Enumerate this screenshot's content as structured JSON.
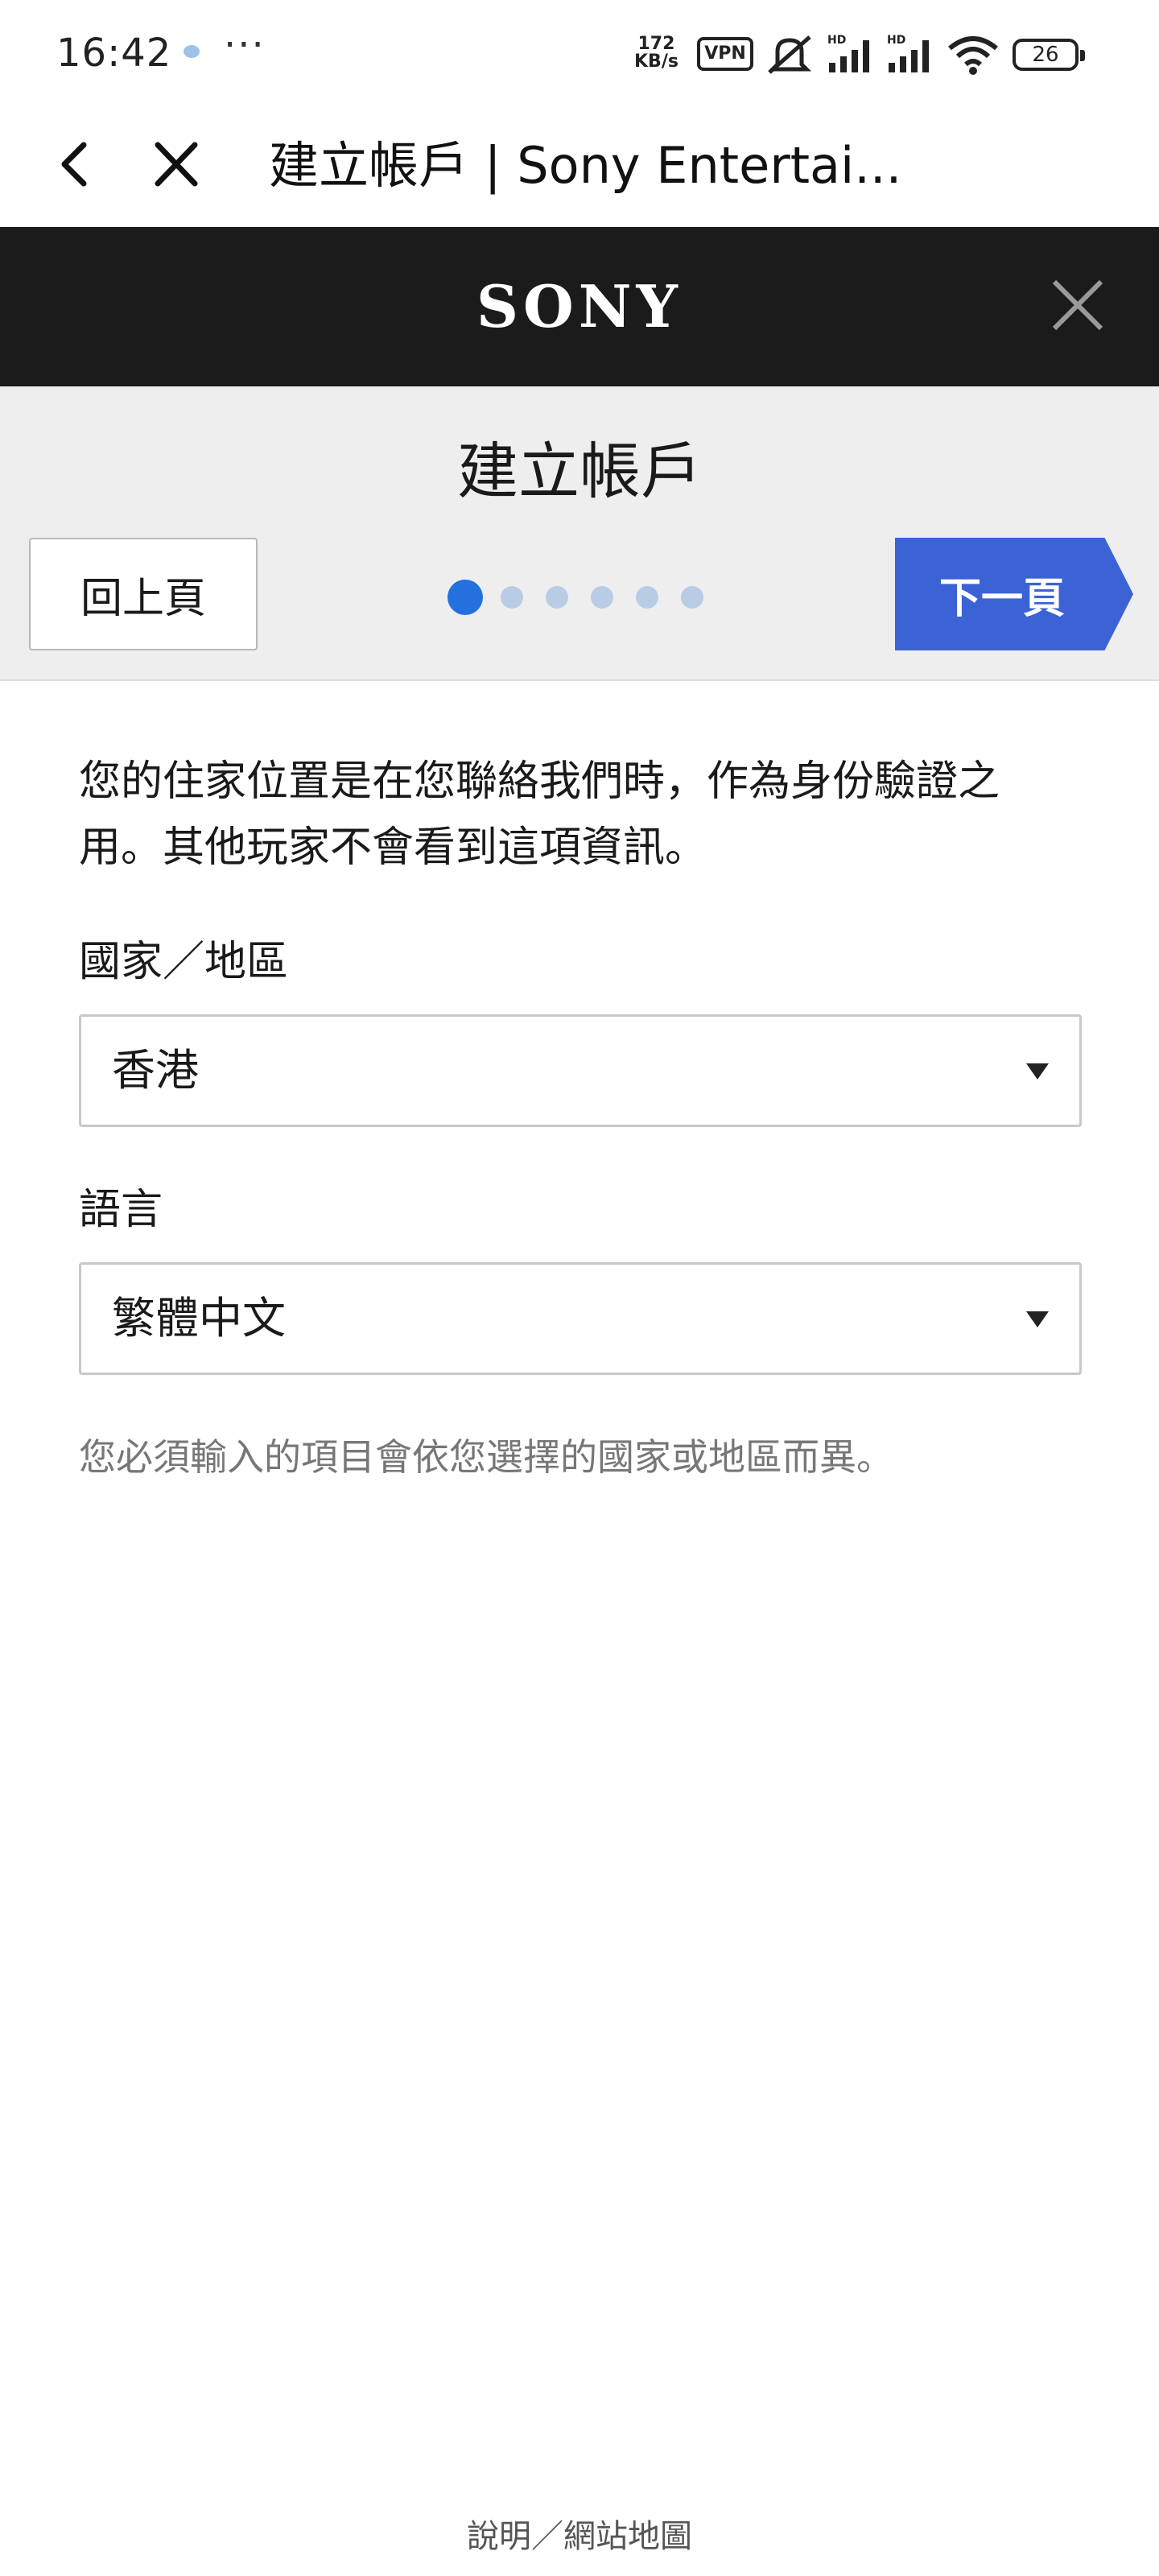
{
  "status_bar": {
    "time": "16:42",
    "more": "···",
    "speed_value": "172",
    "speed_unit": "KB/s",
    "vpn": "VPN",
    "battery": "26"
  },
  "browser": {
    "title": "建立帳戶 | Sony Entertai..."
  },
  "header": {
    "logo": "SONY"
  },
  "steps": {
    "title": "建立帳戶",
    "back_label": "回上頁",
    "next_label": "下一頁",
    "total": 6,
    "current": 1,
    "active_color": "#2470de",
    "inactive_color": "#b9cce6"
  },
  "form": {
    "intro": "您的住家位置是在您聯絡我們時，作為身份驗證之用。其他玩家不會看到這項資訊。",
    "country_label": "國家／地區",
    "country_value": "香港",
    "language_label": "語言",
    "language_value": "繁體中文",
    "note": "您必須輸入的項目會依您選擇的國家或地區而異。"
  },
  "footer": {
    "link": "說明／網站地圖"
  },
  "colors": {
    "header_bg": "#1b1b1b",
    "next_button": "#3b63d6",
    "panel_bg": "#eeeeee"
  }
}
